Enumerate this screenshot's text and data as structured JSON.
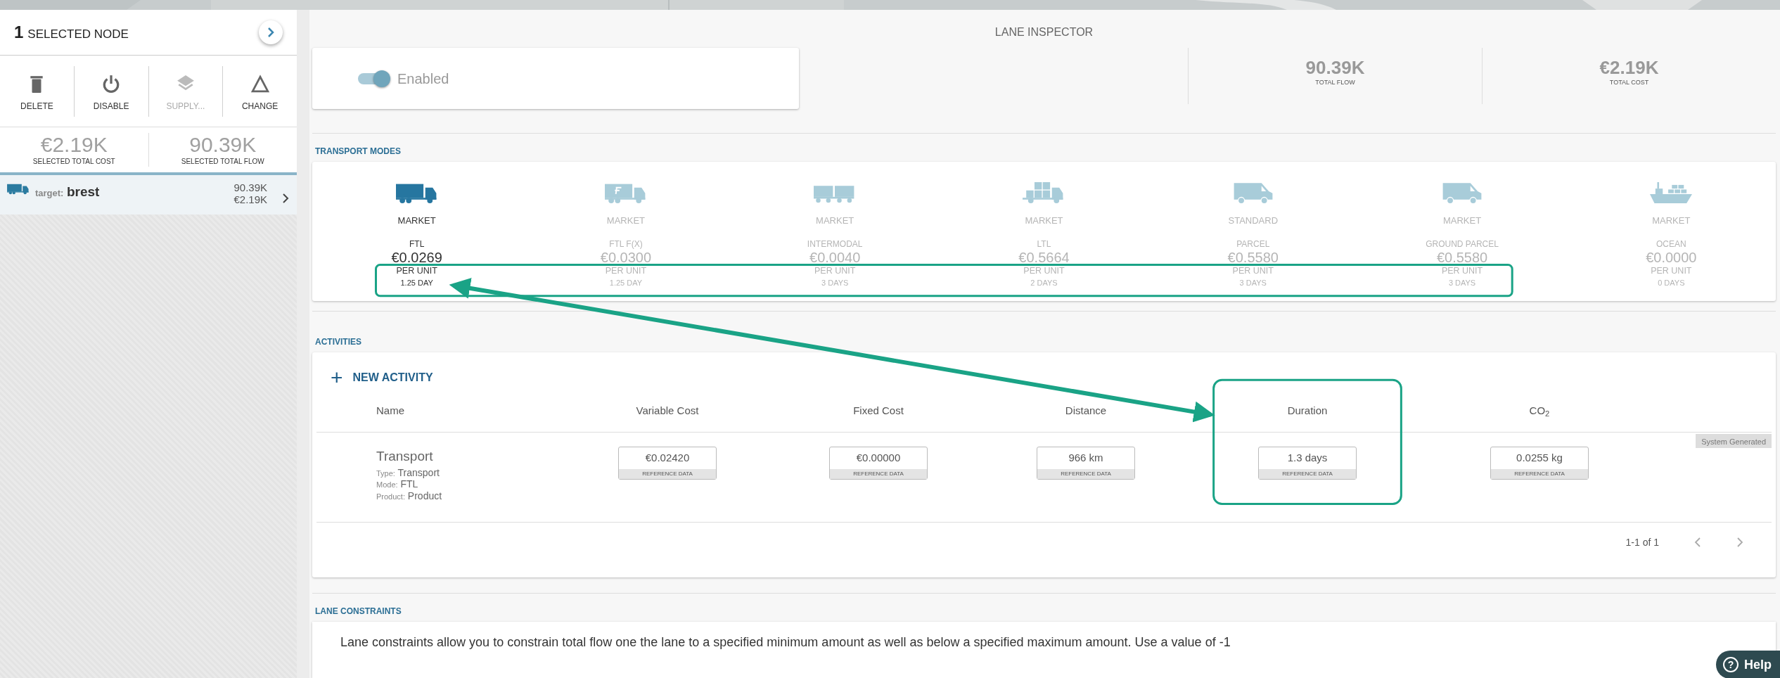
{
  "selection": {
    "count": "1",
    "title": "SELECTED NODE"
  },
  "actions": [
    {
      "kind": "trash",
      "label": "DELETE",
      "disabled": false
    },
    {
      "kind": "power",
      "label": "DISABLE",
      "disabled": false
    },
    {
      "kind": "layers",
      "label": "SUPPLY...",
      "disabled": true
    },
    {
      "kind": "triangle",
      "label": "CHANGE",
      "disabled": false
    }
  ],
  "selection_stats": [
    {
      "value": "€2.19K",
      "label": "SELECTED TOTAL COST"
    },
    {
      "value": "90.39K",
      "label": "SELECTED TOTAL FLOW"
    }
  ],
  "lanes": [
    {
      "prefix": "target:",
      "name": "brest",
      "flow": "90.39K",
      "cost": "€2.19K",
      "selected": true
    }
  ],
  "inspector": {
    "title": "LANE INSPECTOR",
    "toggle": {
      "label": "Enabled",
      "on": true
    },
    "totals": [
      {
        "value": "90.39K",
        "label": "TOTAL FLOW"
      },
      {
        "value": "€2.19K",
        "label": "TOTAL COST"
      }
    ]
  },
  "transport_modes": {
    "title": "TRANSPORT MODES",
    "modes": [
      {
        "kind": "truck",
        "category": "MARKET",
        "mode": "FTL",
        "price": "€0.0269",
        "unit": "PER UNIT",
        "duration": "1.25 DAY",
        "selected": true
      },
      {
        "kind": "fx-truck",
        "category": "MARKET",
        "mode": "FTL F(X)",
        "price": "€0.0300",
        "unit": "PER UNIT",
        "duration": "1.25 DAY",
        "selected": false
      },
      {
        "kind": "rail",
        "category": "MARKET",
        "mode": "INTERMODAL",
        "price": "€0.0040",
        "unit": "PER UNIT",
        "duration": "3 DAYS",
        "selected": false
      },
      {
        "kind": "ltl-truck",
        "category": "MARKET",
        "mode": "LTL",
        "price": "€0.5664",
        "unit": "PER UNIT",
        "duration": "2 DAYS",
        "selected": false
      },
      {
        "kind": "van",
        "category": "STANDARD",
        "mode": "PARCEL",
        "price": "€0.5580",
        "unit": "PER UNIT",
        "duration": "3 DAYS",
        "selected": false
      },
      {
        "kind": "van",
        "category": "MARKET",
        "mode": "GROUND PARCEL",
        "price": "€0.5580",
        "unit": "PER UNIT",
        "duration": "3 DAYS",
        "selected": false
      },
      {
        "kind": "ship",
        "category": "MARKET",
        "mode": "OCEAN",
        "price": "€0.0000",
        "unit": "PER UNIT",
        "duration": "0 DAYS",
        "selected": false
      }
    ]
  },
  "activities": {
    "title": "ACTIVITIES",
    "new_button": {
      "icon": "+",
      "label": "NEW ACTIVITY"
    },
    "columns": [
      "Name",
      "Variable Cost",
      "Fixed Cost",
      "Distance",
      "Duration",
      "CO$_{2}$"
    ],
    "badge": "System Generated",
    "rows": [
      {
        "cells": [
          {
            "kind": "name",
            "value": "Transport",
            "details": [
              {
                "key": "Type:",
                "value": "Transport"
              },
              {
                "key": "Mode:",
                "value": "FTL"
              },
              {
                "key": "Product:",
                "value": "Product"
              }
            ]
          },
          {
            "kind": "field",
            "value": "€0.02420",
            "source": "REFERENCE DATA"
          },
          {
            "kind": "field",
            "value": "€0.00000",
            "source": "REFERENCE DATA"
          },
          {
            "kind": "field",
            "value": "966 km",
            "source": "REFERENCE DATA"
          },
          {
            "kind": "field",
            "value": "1.3 days",
            "source": "REFERENCE DATA"
          },
          {
            "kind": "field",
            "value": "0.0255 kg",
            "source": "REFERENCE DATA"
          }
        ]
      }
    ],
    "pagination": "1-1 of 1"
  },
  "lane_constraints": {
    "title": "LANE CONSTRAINTS",
    "text": "Lane constraints allow you to constrain total flow one the lane to a specified minimum amount as well as below a specified maximum amount. Use a value of -1"
  },
  "help": {
    "icon": "?",
    "label": "Help"
  },
  "annotations": [
    {
      "kind": "mode-frame"
    },
    {
      "kind": "column-frame"
    },
    {
      "kind": "arrow"
    }
  ]
}
